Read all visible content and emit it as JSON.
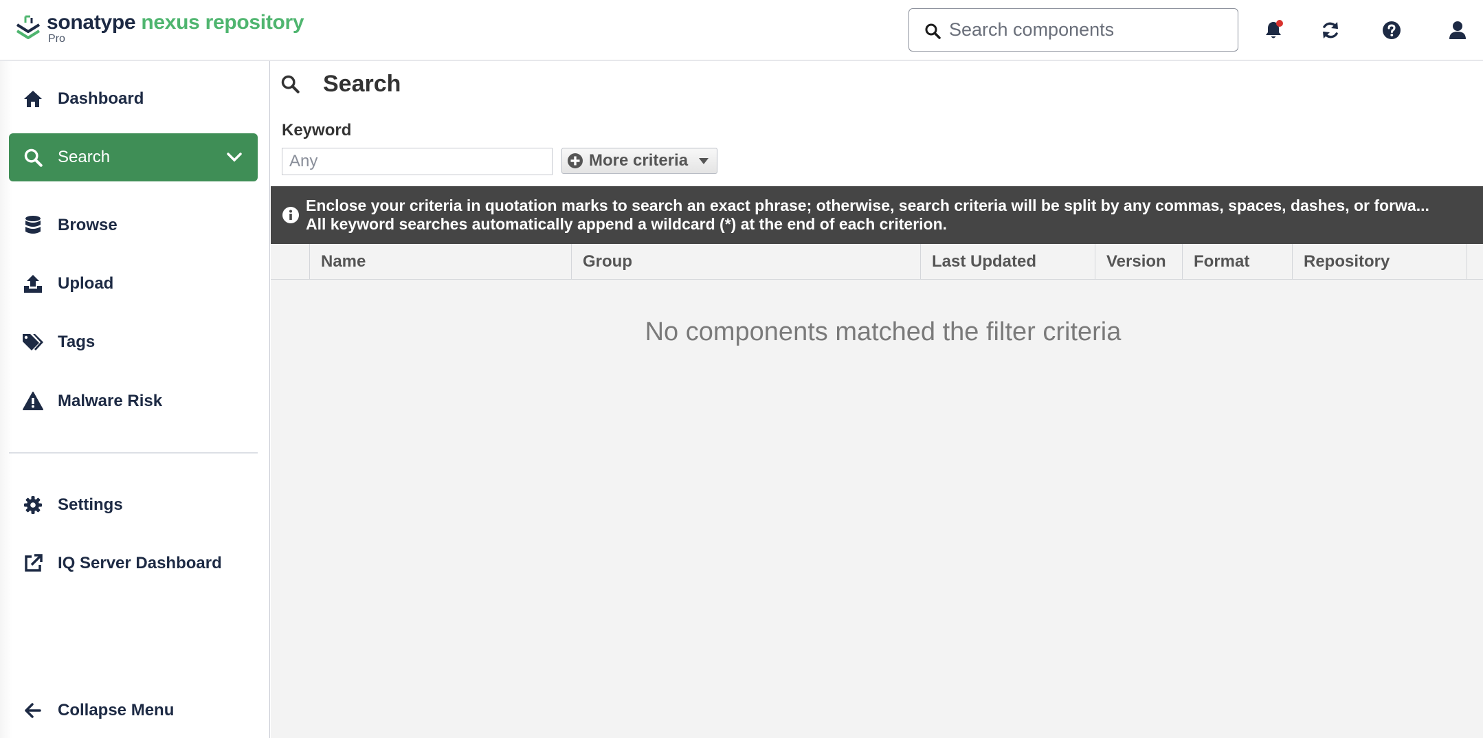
{
  "header": {
    "brand": "sonatype",
    "product": "nexus repository",
    "edition": "Pro",
    "search_placeholder": "Search components"
  },
  "sidebar": {
    "items": [
      {
        "label": "Dashboard",
        "icon": "home-icon"
      },
      {
        "label": "Search",
        "icon": "search-icon",
        "active": true
      },
      {
        "label": "Browse",
        "icon": "database-icon"
      },
      {
        "label": "Upload",
        "icon": "upload-icon"
      },
      {
        "label": "Tags",
        "icon": "tags-icon"
      },
      {
        "label": "Malware Risk",
        "icon": "warning-icon"
      },
      {
        "label": "Settings",
        "icon": "gear-icon"
      },
      {
        "label": "IQ Server Dashboard",
        "icon": "external-link-icon"
      },
      {
        "label": "Collapse Menu",
        "icon": "arrow-left-icon"
      }
    ]
  },
  "main": {
    "title": "Search",
    "keyword_label": "Keyword",
    "keyword_placeholder": "Any",
    "more_criteria_label": "More criteria",
    "info_line1": "Enclose your criteria in quotation marks to search an exact phrase; otherwise, search criteria will be split by any commas, spaces, dashes, or forwa...",
    "info_line2": "All keyword searches automatically append a wildcard (*) at the end of each criterion.",
    "columns": [
      "Name",
      "Group",
      "Last Updated",
      "Version",
      "Format",
      "Repository"
    ],
    "empty_message": "No components matched the filter criteria"
  },
  "colors": {
    "accent_green": "#3f8e56",
    "brand_green": "#4fb56f",
    "navy": "#1d2a44",
    "info_bar": "#454545",
    "notification_dot": "#d8312d"
  }
}
